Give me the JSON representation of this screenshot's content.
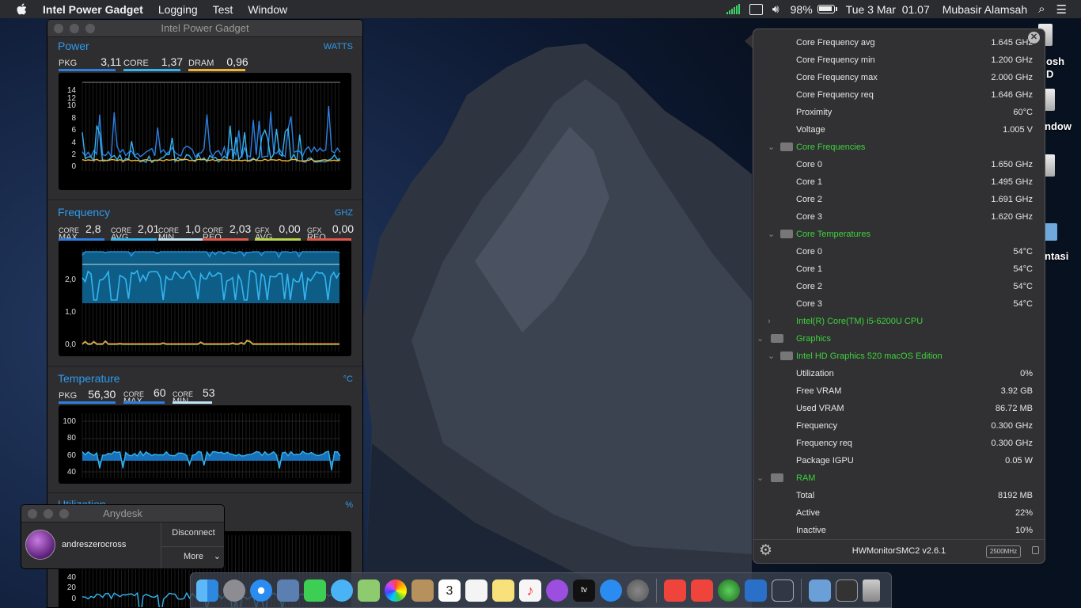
{
  "menubar": {
    "app": "Intel Power Gadget",
    "menus": [
      "Logging",
      "Test",
      "Window"
    ],
    "battery": "98%",
    "datetime": "Tue 3 Mar  01.07",
    "user": "Mubasir Alamsah"
  },
  "desktop": {
    "icon_labels": [
      "osh",
      "D",
      "ndow",
      "ntasi"
    ]
  },
  "ipg": {
    "title": "Intel Power Gadget",
    "power": {
      "title": "Power",
      "unit": "WATTS",
      "metrics": [
        {
          "label": "PKG",
          "value": "3,11",
          "color": "#2d7fe0"
        },
        {
          "label": "CORE",
          "value": "1,37",
          "color": "#35b4f0"
        },
        {
          "label": "DRAM",
          "value": "0,96",
          "color": "#f2b234"
        }
      ],
      "yticks": [
        "14",
        "12",
        "10",
        "8",
        "6",
        "4",
        "2",
        "0"
      ]
    },
    "frequency": {
      "title": "Frequency",
      "unit": "GHZ",
      "metrics": [
        {
          "l1": "CORE",
          "l2": "MAX",
          "value": "2,8",
          "color": "#2d7fe0"
        },
        {
          "l1": "CORE",
          "l2": "AVG",
          "value": "2,01",
          "color": "#35b4f0"
        },
        {
          "l1": "CORE",
          "l2": "MIN",
          "value": "1,0",
          "color": "#bfe4f6"
        },
        {
          "l1": "CORE",
          "l2": "REQ",
          "value": "2,03",
          "color": "#e0584a"
        },
        {
          "l1": "GFX",
          "l2": "AVG",
          "value": "0,00",
          "color": "#b9d64a"
        },
        {
          "l1": "GFX",
          "l2": "REQ",
          "value": "0,00",
          "color": "#e0584a"
        }
      ],
      "yticks": [
        "2,0",
        "1,0",
        "0,0"
      ]
    },
    "temperature": {
      "title": "Temperature",
      "unit": "°C",
      "metrics": [
        {
          "label": "PKG",
          "value": "56,30",
          "color": "#2d7fe0"
        },
        {
          "l1": "CORE",
          "l2": "MAX",
          "value": "60",
          "color": "#2d7fe0"
        },
        {
          "l1": "CORE",
          "l2": "MIN",
          "value": "53",
          "color": "#bfe4f6"
        }
      ],
      "yticks": [
        "100",
        "80",
        "60",
        "40"
      ]
    },
    "utilization": {
      "title": "Utilization",
      "unit": "%",
      "yticks": [
        "40",
        "20",
        "0"
      ]
    }
  },
  "hwmonitor": {
    "rows": [
      {
        "name": "Core Frequency avg",
        "value": "1.645 GHz",
        "type": "item"
      },
      {
        "name": "Core Frequency min",
        "value": "1.200 GHz",
        "type": "item"
      },
      {
        "name": "Core Frequency max",
        "value": "2.000 GHz",
        "type": "item"
      },
      {
        "name": "Core Frequency req",
        "value": "1.646 GHz",
        "type": "item"
      },
      {
        "name": "Proximity",
        "value": "60°C",
        "type": "item"
      },
      {
        "name": "Voltage",
        "value": "1.005 V",
        "type": "item"
      },
      {
        "name": "Core Frequencies",
        "value": "",
        "type": "group"
      },
      {
        "name": "Core 0",
        "value": "1.650 GHz",
        "type": "item"
      },
      {
        "name": "Core 1",
        "value": "1.495 GHz",
        "type": "item"
      },
      {
        "name": "Core 2",
        "value": "1.691 GHz",
        "type": "item"
      },
      {
        "name": "Core 3",
        "value": "1.620 GHz",
        "type": "item"
      },
      {
        "name": "Core Temperatures",
        "value": "",
        "type": "group"
      },
      {
        "name": "Core 0",
        "value": "54°C",
        "type": "item"
      },
      {
        "name": "Core 1",
        "value": "54°C",
        "type": "item"
      },
      {
        "name": "Core 2",
        "value": "54°C",
        "type": "item"
      },
      {
        "name": "Core 3",
        "value": "54°C",
        "type": "item"
      },
      {
        "name": "Intel(R) Core(TM) i5-6200U CPU",
        "value": "",
        "type": "collapsed"
      },
      {
        "name": "Graphics",
        "value": "",
        "type": "top"
      },
      {
        "name": "Intel HD Graphics 520 macOS Edition",
        "value": "",
        "type": "group"
      },
      {
        "name": "Utilization",
        "value": "0%",
        "type": "item"
      },
      {
        "name": "Free VRAM",
        "value": "3.92 GB",
        "type": "item"
      },
      {
        "name": "Used VRAM",
        "value": "86.72 MB",
        "type": "item"
      },
      {
        "name": "Frequency",
        "value": "0.300 GHz",
        "type": "item"
      },
      {
        "name": "Frequency req",
        "value": "0.300 GHz",
        "type": "item"
      },
      {
        "name": "Package IGPU",
        "value": "0.05 W",
        "type": "item"
      },
      {
        "name": "RAM",
        "value": "",
        "type": "top"
      },
      {
        "name": "Total",
        "value": "8192 MB",
        "type": "item"
      },
      {
        "name": "Active",
        "value": "22%",
        "type": "item"
      },
      {
        "name": "Inactive",
        "value": "10%",
        "type": "item"
      }
    ],
    "footer": "HWMonitorSMC2 v2.6.1",
    "badge": "2500MHz"
  },
  "anydesk": {
    "title": "Anydesk",
    "user": "andreszerocross",
    "disconnect": "Disconnect",
    "more": "More"
  },
  "dock": {
    "calendar_day": "3",
    "calendar_month": "MAR"
  }
}
